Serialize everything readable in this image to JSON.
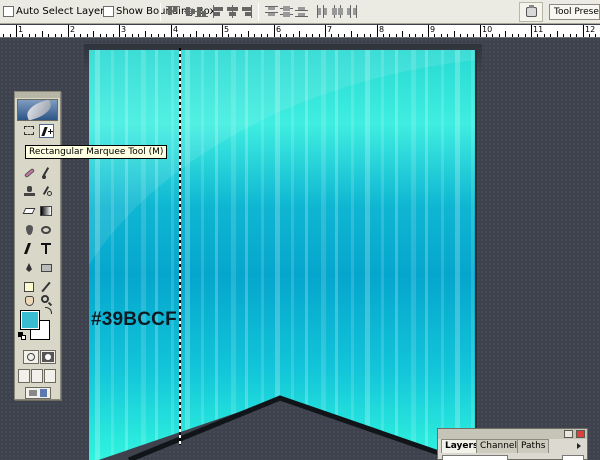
{
  "options_bar": {
    "auto_select_label": "Auto Select Layer",
    "show_bounding_box_label": "Show Bounding Box",
    "tool_presets_label": "Tool Presets"
  },
  "ruler": {
    "labels": [
      "1",
      "2",
      "3",
      "4",
      "5",
      "6",
      "7",
      "8",
      "9",
      "10",
      "11",
      "12"
    ]
  },
  "canvas": {
    "color_label": "#39BCCF"
  },
  "tooltip": {
    "text": "Rectangular Marquee Tool (M)"
  },
  "tools": {
    "foreground_color": "#39BCCF",
    "background_color": "#FFFFFF"
  },
  "layers_panel": {
    "tabs": [
      "Layers",
      "Channels",
      "Paths"
    ],
    "active_tab": "Layers"
  },
  "colors": {
    "banner_top": "#1fe0d2",
    "banner_mid": "#06a9cf",
    "banner_bottom": "#2ef2dc",
    "workspace": "#3d424d"
  }
}
